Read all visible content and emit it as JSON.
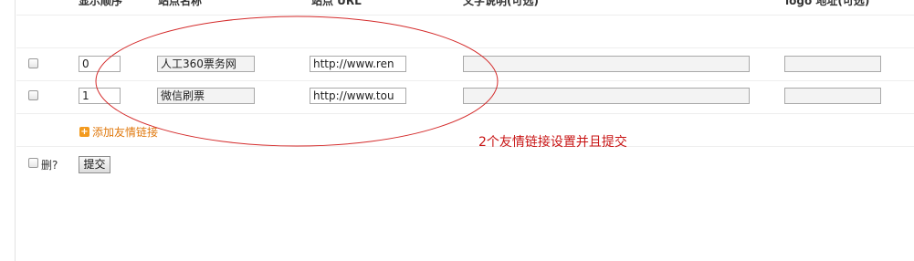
{
  "headers": [
    "显示顺序",
    "站点名称",
    "站点 URL",
    "文字说明(可选)",
    "logo 地址(可选)"
  ],
  "rows": [
    {
      "order": "0",
      "name": "人工360票务网",
      "url": "http://www.ren",
      "desc": "",
      "logo": ""
    },
    {
      "order": "1",
      "name": "微信刷票",
      "url": "http://www.tou",
      "desc": "",
      "logo": ""
    }
  ],
  "add_link_label": "添加友情链接",
  "delete_label": "删?",
  "submit_label": "提交",
  "annotation": "2个友情链接设置并且提交",
  "colors": {
    "annotation": "#c81414",
    "add_link": "#e07a10"
  }
}
